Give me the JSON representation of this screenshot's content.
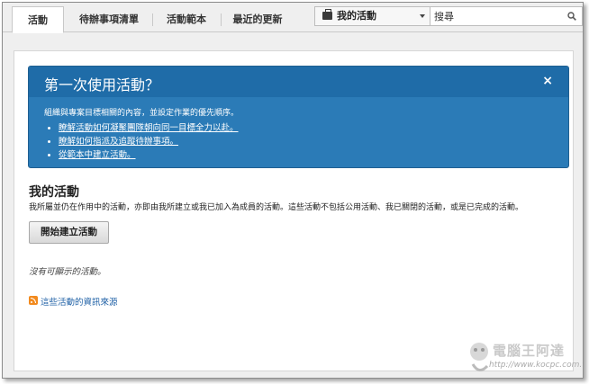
{
  "tabs": [
    {
      "label": "活動",
      "active": true
    },
    {
      "label": "待辦事項清單",
      "active": false
    },
    {
      "label": "活動範本",
      "active": false
    },
    {
      "label": "最近的更新",
      "active": false
    }
  ],
  "scope_select": {
    "value": "我的活動",
    "icon": "briefcase-icon"
  },
  "search": {
    "placeholder": "搜尋",
    "icon": "search-icon"
  },
  "banner": {
    "title": "第一次使用活動？",
    "close": "×",
    "description": "組織與專案目標相關的內容，並設定作業的優先順序。",
    "links": [
      "瞭解活動如何凝聚團隊朝向同一目標全力以赴。",
      "瞭解如何指派及追蹤待辦事項。",
      "從範本中建立活動。"
    ],
    "color": "#2b7bb7"
  },
  "main": {
    "title": "我的活動",
    "description": "我所屬並仍在作用中的活動，亦即由我所建立或我已加入為成員的活動。這些活動不包括公用活動、我已關閉的活動，或是已完成的活動。",
    "start_button": "開始建立活動",
    "empty_message": "沒有可顯示的活動。",
    "feed_link": "這些活動的資訊來源",
    "feed_icon": "rss-icon"
  },
  "watermark": {
    "brand": "電腦王阿達",
    "url": "http://www.kocpc.com.tw"
  }
}
